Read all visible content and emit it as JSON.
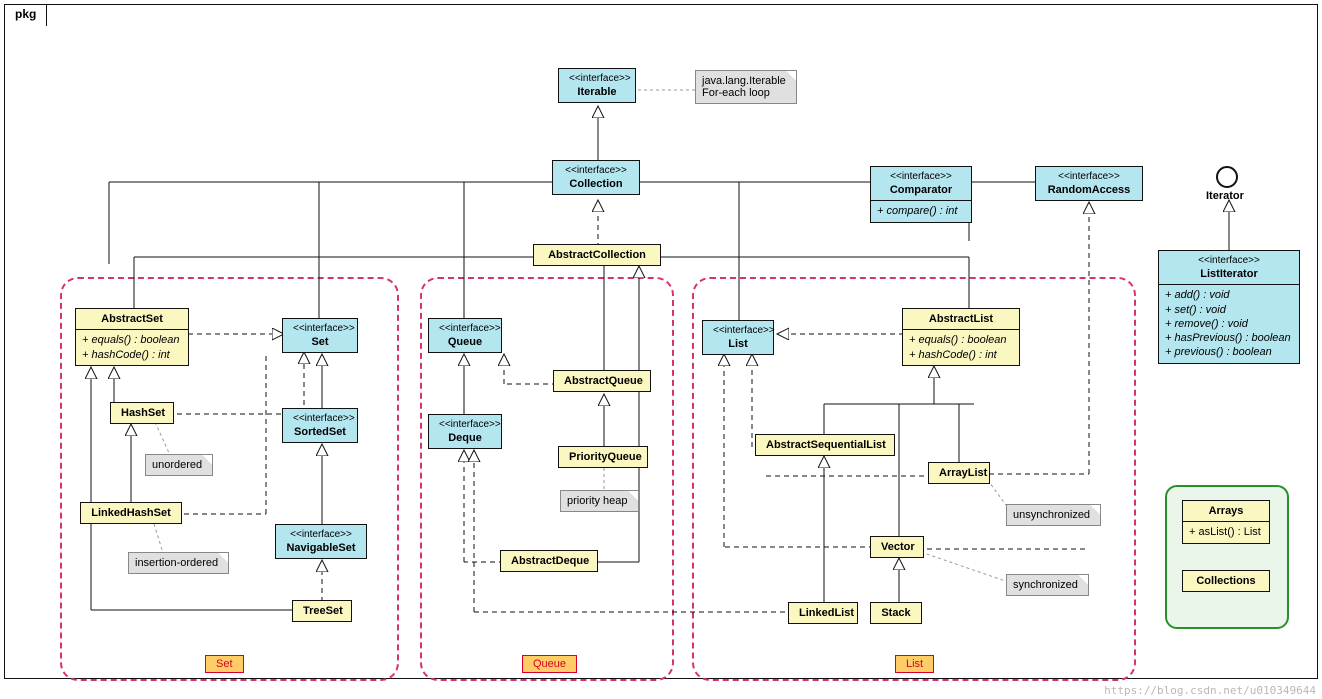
{
  "pkg_label": "pkg",
  "watermark": "https://blog.csdn.net/u010349644",
  "stereo": "<<interface>>",
  "group_tags": {
    "set": "Set",
    "queue": "Queue",
    "list": "List"
  },
  "iterable": {
    "name": "Iterable"
  },
  "iterable_note_l1": "java.lang.Iterable",
  "iterable_note_l2": "For-each loop",
  "collection": {
    "name": "Collection"
  },
  "abstract_collection": {
    "name": "AbstractCollection"
  },
  "abstract_set": {
    "name": "AbstractSet",
    "m1": "+ equals() : boolean",
    "m2": "+ hashCode() : int"
  },
  "set": {
    "name": "Set"
  },
  "sorted_set": {
    "name": "SortedSet"
  },
  "navigable_set": {
    "name": "NavigableSet"
  },
  "hash_set": {
    "name": "HashSet"
  },
  "linked_hash_set": {
    "name": "LinkedHashSet"
  },
  "tree_set": {
    "name": "TreeSet"
  },
  "note_unordered": "unordered",
  "note_insertion": "insertion-ordered",
  "queue": {
    "name": "Queue"
  },
  "deque": {
    "name": "Deque"
  },
  "abstract_queue": {
    "name": "AbstractQueue"
  },
  "priority_queue": {
    "name": "PriorityQueue"
  },
  "abstract_deque": {
    "name": "AbstractDeque"
  },
  "note_pheap": "priority heap",
  "list": {
    "name": "List"
  },
  "abstract_list": {
    "name": "AbstractList",
    "m1": "+ equals() : boolean",
    "m2": "+ hashCode() : int"
  },
  "abstract_seq_list": {
    "name": "AbstractSequentialList"
  },
  "array_list": {
    "name": "ArrayList"
  },
  "vector": {
    "name": "Vector"
  },
  "stack": {
    "name": "Stack"
  },
  "linked_list": {
    "name": "LinkedList"
  },
  "note_unsync": "unsynchronized",
  "note_sync": "synchronized",
  "comparator": {
    "name": "Comparator",
    "m1": "+ compare() : int"
  },
  "random_access": {
    "name": "RandomAccess"
  },
  "iterator_label": "Iterator",
  "list_iterator": {
    "name": "ListIterator",
    "m1": "+ add() : void",
    "m2": "+ set() : void",
    "m3": "+ remove() : void",
    "m4": "+ hasPrevious() : boolean",
    "m5": "+ previous() : boolean"
  },
  "arrays": {
    "name": "Arrays",
    "m1": "+ asList() : List"
  },
  "collections": {
    "name": "Collections"
  }
}
